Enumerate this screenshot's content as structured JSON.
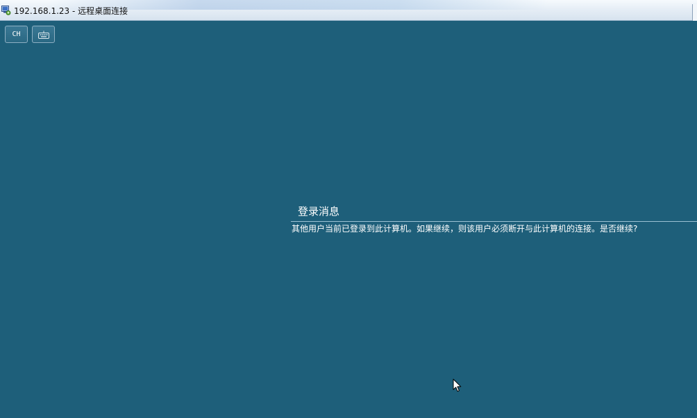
{
  "window": {
    "title": "192.168.1.23 - 远程桌面连接",
    "background_color": "#1e5f7a"
  },
  "toolbar": {
    "language_button_label": "CH",
    "keyboard_button_icon": "keyboard-icon"
  },
  "message": {
    "title": "登录消息",
    "body": "其他用户当前已登录到此计算机。如果继续，则该用户必须断开与此计算机的连接。是否继续?"
  },
  "cursor": {
    "icon": "mouse-pointer-icon"
  }
}
